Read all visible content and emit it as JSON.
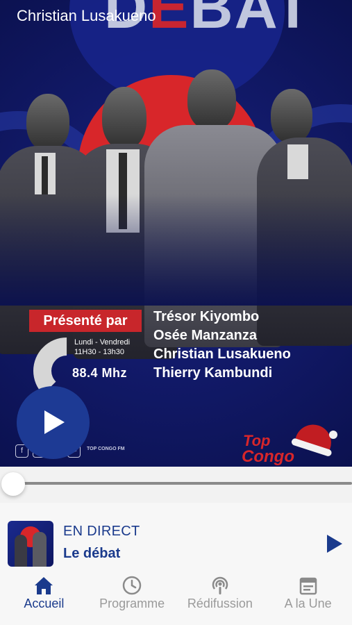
{
  "header": {
    "title": "Christian Lusakueno"
  },
  "poster": {
    "show_word_a": "D",
    "show_word_b": "E",
    "show_word_c": "BAT",
    "presented_by": "Présenté par",
    "schedule_days": "Lundi - Vendredi",
    "schedule_hours": "11H30 - 13h30",
    "frequency": "88.4 Mhz",
    "presenters": [
      "Trésor Kiyombo",
      "Osée Manzanza",
      "Christian Lusakueno",
      "Thierry Kambundi"
    ],
    "social_handle": "TOP CONGO FM",
    "brand_line1": "Top",
    "brand_line2": "Congo"
  },
  "player": {
    "progress": 0.0,
    "live_label": "EN DIRECT",
    "show_title": "Le débat"
  },
  "tabs": [
    {
      "label": "Accueil",
      "icon": "home-icon",
      "active": true
    },
    {
      "label": "Programme",
      "icon": "clock-icon",
      "active": false
    },
    {
      "label": "Rédifussion",
      "icon": "podcast-icon",
      "active": false
    },
    {
      "label": "A la Une",
      "icon": "calendar-icon",
      "active": false
    }
  ],
  "colors": {
    "accent": "#1a3a8c",
    "red": "#d8262a",
    "poster_bg": "#121a6a",
    "inactive": "#9a9a9a"
  }
}
